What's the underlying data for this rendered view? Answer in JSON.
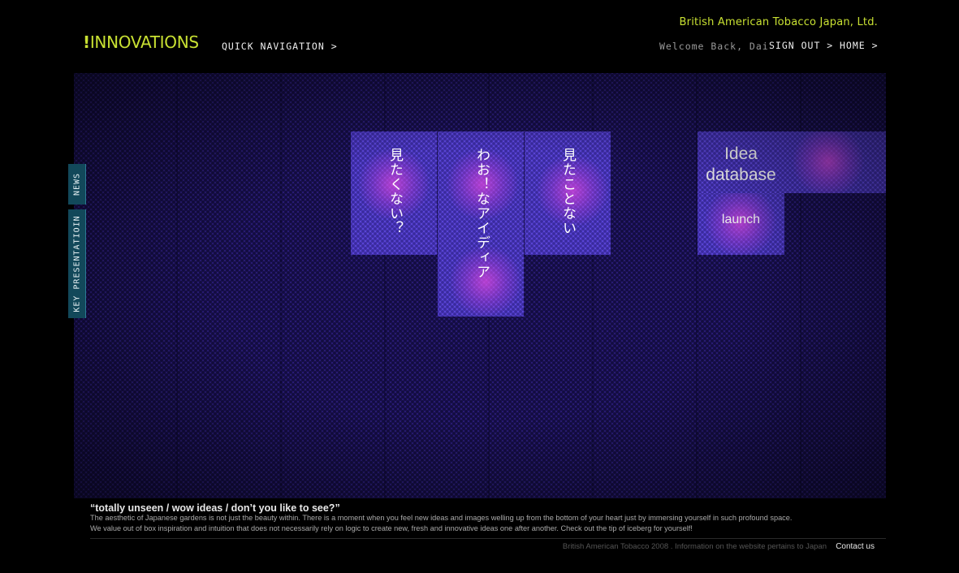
{
  "header": {
    "company": "British American Tobacco Japan, Ltd.",
    "logo_bang": "!",
    "logo_text": "INNOVATIONS",
    "quick_nav": "QUICK NAVIGATION >",
    "welcome": "Welcome Back, Dai",
    "sign_out": "SIGN OUT >",
    "home": "HOME >"
  },
  "tiles": {
    "tile1": "見たくない？",
    "tile2": "わお！なアイディア",
    "tile3": "見たことない",
    "idea_line1": "Idea",
    "idea_line2": "database",
    "launch": "launch"
  },
  "side_tabs": {
    "news": "NEWS",
    "key_presentation": "KEY PRESENTATIOIN"
  },
  "footer": {
    "quote": "“totally unseen / wow ideas / don’t you like to see?”",
    "description_line1": "The aesthetic of Japanese gardens is not just the beauty within. There is a moment when you feel new ideas and images welling up from the bottom of your heart just by immersing yourself in such profound space.",
    "description_line2": "We value out of box inspiration and intuition that does not necessarily rely on logic to create new, fresh and innovative ideas one after another. Check out the tip of iceberg for yourself!",
    "copyright": "British American Tobacco 2008 . Information on the website pertains to Japan",
    "contact": "Contact us"
  },
  "colors": {
    "accent": "#c8e032",
    "stage": "#2a1d78",
    "tile": "#5a45d6",
    "side_tab": "#12485a"
  }
}
